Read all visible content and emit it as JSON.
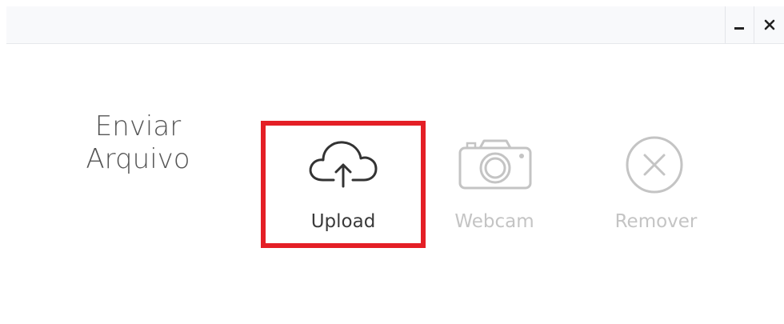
{
  "titlebar": {
    "minimize_icon": "minimize-icon",
    "close_icon": "close-icon"
  },
  "prompt": {
    "line1": "Enviar",
    "line2": "Arquivo"
  },
  "actions": {
    "upload": {
      "label": "Upload",
      "icon": "cloud-upload-icon",
      "highlighted": true,
      "highlight_color": "#e41f26",
      "enabled": true
    },
    "webcam": {
      "label": "Webcam",
      "icon": "camera-icon",
      "enabled": false
    },
    "remove": {
      "label": "Remover",
      "icon": "circle-x-icon",
      "enabled": false
    }
  },
  "colors": {
    "text_active": "#3a3a3a",
    "text_disabled": "#c4c4c4",
    "highlight": "#e41f26"
  }
}
